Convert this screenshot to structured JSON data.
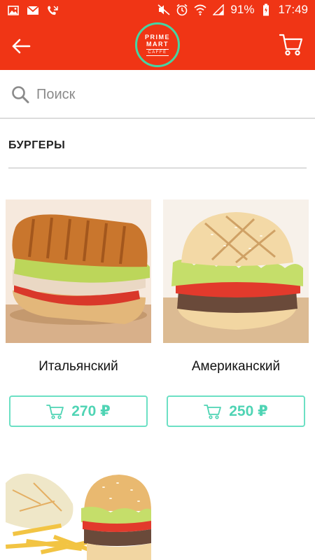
{
  "status_bar": {
    "battery": "91%",
    "time": "17:49"
  },
  "header": {
    "logo": {
      "line1": "PRIME",
      "line2": "MART",
      "line3": "CAFFÈ"
    }
  },
  "search": {
    "placeholder": "Поиск"
  },
  "section": {
    "title": "БУРГЕРЫ"
  },
  "products": [
    {
      "name": "Итальянский",
      "price": "270 ₽"
    },
    {
      "name": "Американский",
      "price": "250 ₽"
    },
    {
      "name": "",
      "price": ""
    }
  ],
  "colors": {
    "brand_red": "#f03515",
    "accent_mint": "#4fd4b4"
  },
  "icons": {
    "back": "arrow-left-icon",
    "cart": "cart-icon",
    "search": "search-icon"
  }
}
